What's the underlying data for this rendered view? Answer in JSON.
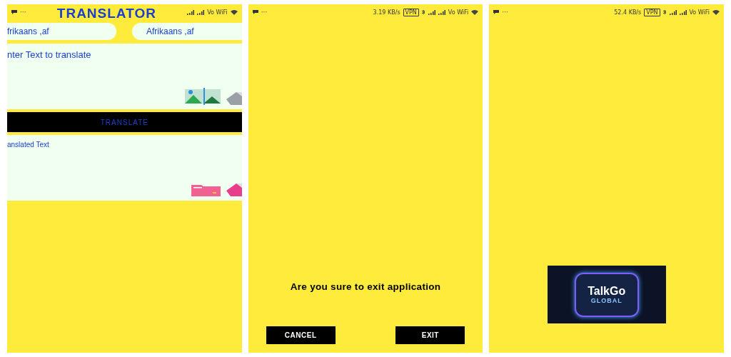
{
  "screens": [
    {
      "kind": "translator",
      "status_bar": {
        "dots": "···",
        "wifi_label": "Vo WiFi"
      },
      "title": "TRANSLATOR",
      "languages": [
        {
          "label": "frikaans ,af"
        },
        {
          "label": "Afrikaans ,af"
        }
      ],
      "input": {
        "placeholder": "nter Text to translate"
      },
      "translate_button": "TRANSLATE",
      "output": {
        "placeholder": "anslated Text"
      }
    },
    {
      "kind": "exit_dialog",
      "status_bar": {
        "dots": "···",
        "speed": "3.19 KB/s",
        "vpn": "VPN",
        "wifi_label": "Vo WiFi"
      },
      "message": "Are you sure to exit application",
      "buttons": [
        "CANCEL",
        "EXIT"
      ]
    },
    {
      "kind": "splash",
      "status_bar": {
        "dots": "···",
        "speed": "52.4 KB/s",
        "vpn": "VPN",
        "wifi_label": "Vo WiFi"
      },
      "logo": {
        "line_1": "TalkGo",
        "line_2": "GLOBAL"
      }
    }
  ]
}
